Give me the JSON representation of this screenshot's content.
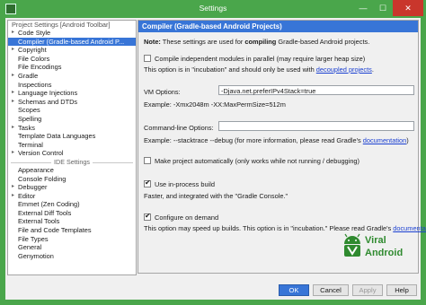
{
  "window": {
    "title": "Settings",
    "min": "—",
    "max": "☐",
    "close": "✕"
  },
  "sidebar": {
    "section_label": "Project Settings [Android Toolbar]",
    "project_items": [
      {
        "label": "Code Style",
        "arrow": "▸"
      },
      {
        "label": "Compiler (Gradle-based Android P...",
        "arrow": "",
        "selected": true
      },
      {
        "label": "Copyright",
        "arrow": "▸"
      },
      {
        "label": "File Colors",
        "arrow": ""
      },
      {
        "label": "File Encodings",
        "arrow": ""
      },
      {
        "label": "Gradle",
        "arrow": "▸"
      },
      {
        "label": "Inspections",
        "arrow": ""
      },
      {
        "label": "Language Injections",
        "arrow": "▸"
      },
      {
        "label": "Schemas and DTDs",
        "arrow": "▸"
      },
      {
        "label": "Scopes",
        "arrow": ""
      },
      {
        "label": "Spelling",
        "arrow": ""
      },
      {
        "label": "Tasks",
        "arrow": "▸"
      },
      {
        "label": "Template Data Languages",
        "arrow": ""
      },
      {
        "label": "Terminal",
        "arrow": ""
      },
      {
        "label": "Version Control",
        "arrow": "▸"
      }
    ],
    "ide_label": "IDE Settings",
    "ide_items": [
      {
        "label": "Appearance",
        "arrow": ""
      },
      {
        "label": "Console Folding",
        "arrow": ""
      },
      {
        "label": "Debugger",
        "arrow": "▸"
      },
      {
        "label": "Editor",
        "arrow": "▸"
      },
      {
        "label": "Emmet (Zen Coding)",
        "arrow": ""
      },
      {
        "label": "External Diff Tools",
        "arrow": ""
      },
      {
        "label": "External Tools",
        "arrow": ""
      },
      {
        "label": "File and Code Templates",
        "arrow": ""
      },
      {
        "label": "File Types",
        "arrow": ""
      },
      {
        "label": "General",
        "arrow": ""
      },
      {
        "label": "Genymotion",
        "arrow": ""
      }
    ]
  },
  "panel": {
    "title": "Compiler (Gradle-based Android Projects)",
    "note_bold": "Note:",
    "note_a": " These settings are used for ",
    "note_bold2": "compiling",
    "note_b": " Gradle-based Android projects.",
    "parallel_label": "Compile independent modules in parallel (may require larger heap size)",
    "parallel_checked": false,
    "parallel_desc": "This option is in \"incubation\" and should only be used with ",
    "parallel_link": "decoupled projects",
    "parallel_end": ".",
    "vm_label": "VM Options:",
    "vm_value": "-Djava.net.preferIPv4Stack=true",
    "vm_example": "Example: -Xmx2048m -XX:MaxPermSize=512m",
    "cli_label": "Command-line Options:",
    "cli_value": "",
    "cli_example": "Example: --stacktrace --debug (for more information, please read Gradle's ",
    "cli_link": "documentation",
    "cli_end": ")",
    "make_label": "Make project automatically (only works while not running / debugging)",
    "make_checked": false,
    "inproc_label": "Use in-process build",
    "inproc_checked": true,
    "inproc_desc": "Faster, and integrated with the \"Gradle Console.\"",
    "demand_label": "Configure on demand",
    "demand_checked": true,
    "demand_desc": "This option may speed up builds. This option is in \"incubation.\" Please read Gradle's ",
    "demand_link": "documentation",
    "demand_end": "."
  },
  "watermark": {
    "line1": "Viral",
    "line2": "Android"
  },
  "footer": {
    "ok": "OK",
    "cancel": "Cancel",
    "apply": "Apply",
    "help": "Help"
  },
  "colors": {
    "accent": "#3875d7",
    "titlebar": "#4aa64b",
    "close": "#c9362c",
    "link": "#1a3fd1",
    "watermark": "#2f8a2f"
  }
}
